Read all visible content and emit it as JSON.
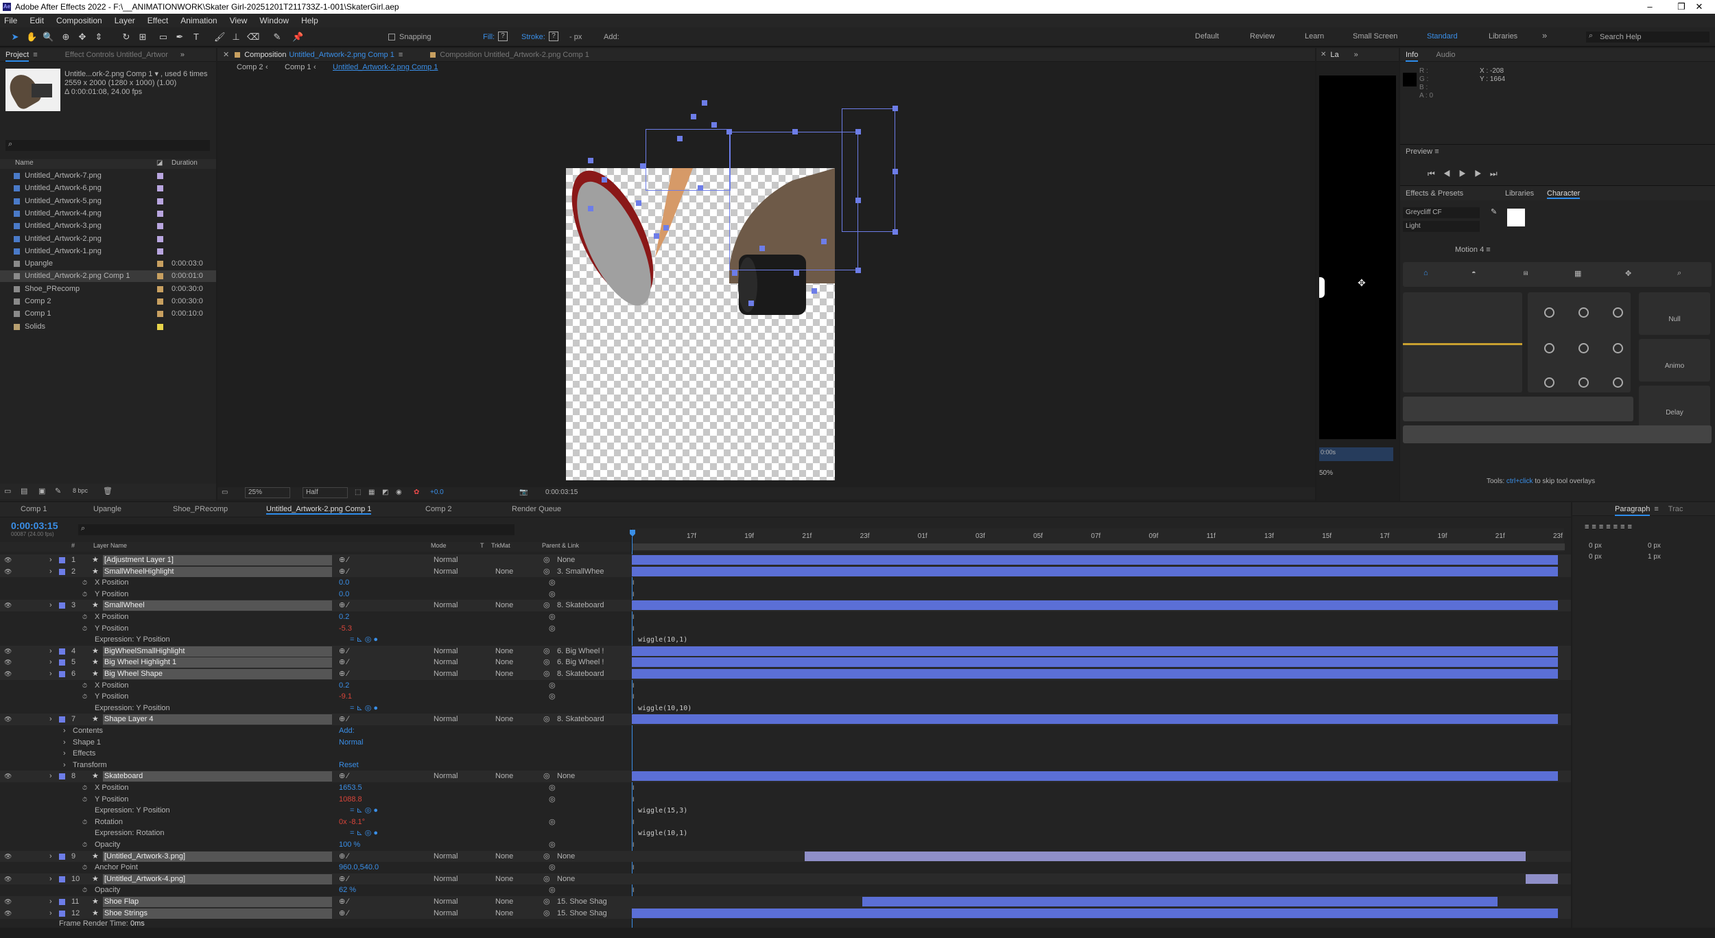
{
  "window": {
    "title": "Adobe After Effects 2022 - F:\\__ANIMATIONWORK\\Skater Girl-20251201T211733Z-1-001\\SkaterGirl.aep",
    "min": "–",
    "max": "❐",
    "close": "✕"
  },
  "menu": [
    "File",
    "Edit",
    "Composition",
    "Layer",
    "Effect",
    "Animation",
    "View",
    "Window",
    "Help"
  ],
  "toolbar": {
    "snapping": "Snapping",
    "fill": "Fill:",
    "stroke": "Stroke:",
    "px": "- px",
    "add": "Add:"
  },
  "workspaces": [
    "Default",
    "Review",
    "Learn",
    "Small Screen",
    "Standard",
    "Libraries"
  ],
  "search_help": "Search Help",
  "project": {
    "tab": "Project",
    "effect_controls": "Effect Controls Untitled_Artwor",
    "thumb_name": "Untitle...ork-2.png Comp 1 ▾ , used 6 times",
    "thumb_dims": "2559 x 2000  (1280 x 1000) (1.00)",
    "thumb_dur": "Δ 0:00:01:08, 24.00 fps",
    "col_name": "Name",
    "col_duration": "Duration",
    "items": [
      {
        "name": "Untitled_Artwork-7.png",
        "dur": "",
        "color": "#b9a6e0"
      },
      {
        "name": "Untitled_Artwork-6.png",
        "dur": "",
        "color": "#b9a6e0"
      },
      {
        "name": "Untitled_Artwork-5.png",
        "dur": "",
        "color": "#b9a6e0"
      },
      {
        "name": "Untitled_Artwork-4.png",
        "dur": "",
        "color": "#b9a6e0"
      },
      {
        "name": "Untitled_Artwork-3.png",
        "dur": "",
        "color": "#b9a6e0"
      },
      {
        "name": "Untitled_Artwork-2.png",
        "dur": "",
        "color": "#b9a6e0"
      },
      {
        "name": "Untitled_Artwork-1.png",
        "dur": "",
        "color": "#b9a6e0"
      },
      {
        "name": "Upangle",
        "dur": "0:00:03:0",
        "color": "#c8a060"
      },
      {
        "name": "Untitled_Artwork-2.png Comp 1",
        "dur": "0:00:01:0",
        "color": "#c8a060"
      },
      {
        "name": "Shoe_PRecomp",
        "dur": "0:00:30:0",
        "color": "#c8a060"
      },
      {
        "name": "Comp 2",
        "dur": "0:00:30:0",
        "color": "#c8a060"
      },
      {
        "name": "Comp 1",
        "dur": "0:00:10:0",
        "color": "#c8a060"
      },
      {
        "name": "Solids",
        "dur": "",
        "color": "#e8d44a"
      }
    ],
    "bpc": "8 bpc"
  },
  "viewer": {
    "tab_comp": "Composition",
    "tab_comp_name": "Untitled_Artwork-2.png Comp 1",
    "tab_other": "Composition Untitled_Artwork-2.png Comp 1",
    "crumbs": [
      "Comp 2",
      "Comp 1",
      "Untitled_Artwork-2.png Comp 1"
    ],
    "zoom": "25%",
    "res": "Half",
    "exposure": "+0.0",
    "time": "0:00:03:15"
  },
  "layer_panel": {
    "tab": "La",
    "time": "0:00s",
    "zoom": "50%"
  },
  "info": {
    "tab": "Info",
    "audio": "Audio",
    "r": "R :",
    "g": "G :",
    "b": "B :",
    "a": "A : 0",
    "x": "X : -208",
    "y": "Y : 1664"
  },
  "preview": {
    "title": "Preview"
  },
  "effects_tabs": [
    "Effects & Presets",
    "Libraries",
    "Character"
  ],
  "character": {
    "font": "Greycliff CF",
    "style": "Light"
  },
  "motion": {
    "title": "Motion 4",
    "null": "Null",
    "animo": "Animo",
    "delay": "Delay",
    "hint_a": "Tools:",
    "hint_b": "ctrl+click",
    "hint_c": "to skip tool overlays"
  },
  "paragraph": {
    "tab": "Paragraph",
    "trac": "Trac",
    "t1": "0 px",
    "t2": "0 px",
    "t3": "0 px",
    "t4": "0 px",
    "t5": "1 px"
  },
  "timeline": {
    "tabs": [
      "Comp 1",
      "Upangle",
      "Shoe_PRecomp",
      "Untitled_Artwork-2.png Comp 1",
      "Comp 2",
      "Render Queue"
    ],
    "time": "0:00:03:15",
    "fps": "00087 (24.00 fps)",
    "cols": {
      "num": "#",
      "name": "Layer Name",
      "mode": "Mode",
      "t": "T",
      "trkmat": "TrkMat",
      "parent": "Parent & Link"
    },
    "ruler": [
      "17f",
      "19f",
      "21f",
      "23f",
      "01f",
      "03f",
      "05f",
      "07f",
      "09f",
      "11f",
      "13f",
      "15f",
      "17f",
      "19f",
      "21f",
      "23f"
    ],
    "rows": [
      {
        "t": "layer",
        "n": "1",
        "name": "[Adjustment Layer 1]",
        "mode": "Normal",
        "trk": "",
        "parent": "None",
        "bar": [
          0,
          1
        ],
        "bc": "#5b6fd6"
      },
      {
        "t": "layer",
        "n": "2",
        "name": "SmallWheelHighlight",
        "mode": "Normal",
        "trk": "None",
        "parent": "3. SmallWhee",
        "bar": [
          0,
          1
        ],
        "bc": "#5b6fd6"
      },
      {
        "t": "prop",
        "name": "X Position",
        "val": "0.0",
        "vc": "#3a8fe8"
      },
      {
        "t": "prop",
        "name": "Y Position",
        "val": "0.0",
        "vc": "#3a8fe8"
      },
      {
        "t": "layer",
        "n": "3",
        "name": "SmallWheel",
        "mode": "Normal",
        "trk": "None",
        "parent": "8. Skateboard",
        "bar": [
          0,
          1
        ],
        "bc": "#5b6fd6"
      },
      {
        "t": "prop",
        "name": "X Position",
        "val": "0.2",
        "vc": "#3a8fe8"
      },
      {
        "t": "prop",
        "name": "Y Position",
        "val": "-5.3",
        "vc": "#d9453a"
      },
      {
        "t": "expr",
        "name": "Expression: Y Position",
        "code": "wiggle(10,1)"
      },
      {
        "t": "layer",
        "n": "4",
        "name": "BigWheelSmallHighlight",
        "mode": "Normal",
        "trk": "None",
        "parent": "6. Big Wheel !",
        "bar": [
          0,
          1
        ],
        "bc": "#5b6fd6"
      },
      {
        "t": "layer",
        "n": "5",
        "name": "Big Wheel Highlight 1",
        "mode": "Normal",
        "trk": "None",
        "parent": "6. Big Wheel !",
        "bar": [
          0,
          1
        ],
        "bc": "#5b6fd6"
      },
      {
        "t": "layer",
        "n": "6",
        "name": "Big Wheel Shape",
        "mode": "Normal",
        "trk": "None",
        "parent": "8. Skateboard",
        "bar": [
          0,
          1
        ],
        "bc": "#5b6fd6"
      },
      {
        "t": "prop",
        "name": "X Position",
        "val": "0.2",
        "vc": "#3a8fe8"
      },
      {
        "t": "prop",
        "name": "Y Position",
        "val": "-9.1",
        "vc": "#d9453a"
      },
      {
        "t": "expr",
        "name": "Expression: Y Position",
        "code": "wiggle(10,10)"
      },
      {
        "t": "layer",
        "n": "7",
        "name": "Shape Layer 4",
        "mode": "Normal",
        "trk": "None",
        "parent": "8. Skateboard",
        "bar": [
          0,
          1
        ],
        "bc": "#5b6fd6"
      },
      {
        "t": "group",
        "name": "Contents",
        "extra": "Add:"
      },
      {
        "t": "group",
        "name": "Shape 1",
        "extra": "Normal"
      },
      {
        "t": "group",
        "name": "Effects",
        "extra": ""
      },
      {
        "t": "group",
        "name": "Transform",
        "extra": "Reset"
      },
      {
        "t": "layer",
        "n": "8",
        "name": "Skateboard",
        "mode": "Normal",
        "trk": "None",
        "parent": "None",
        "bar": [
          0,
          1
        ],
        "bc": "#5b6fd6"
      },
      {
        "t": "prop",
        "name": "X Position",
        "val": "1653.5",
        "vc": "#3a8fe8"
      },
      {
        "t": "prop",
        "name": "Y Position",
        "val": "1088.8",
        "vc": "#d9453a"
      },
      {
        "t": "expr",
        "name": "Expression: Y Position",
        "code": "wiggle(15,3)"
      },
      {
        "t": "prop",
        "name": "Rotation",
        "val": "0x -8.1°",
        "vc": "#d9453a"
      },
      {
        "t": "expr",
        "name": "Expression: Rotation",
        "code": "wiggle(10,1)"
      },
      {
        "t": "prop",
        "name": "Opacity",
        "val": "100 %",
        "vc": "#3a8fe8"
      },
      {
        "t": "layer",
        "n": "9",
        "name": "[Untitled_Artwork-3.png]",
        "mode": "Normal",
        "trk": "None",
        "parent": "None",
        "bar": [
          0.187,
          0.965
        ],
        "bc": "#8f8fc8"
      },
      {
        "t": "prop",
        "name": "Anchor Point",
        "val": "960.0,540.0",
        "vc": "#3a8fe8"
      },
      {
        "t": "layer",
        "n": "10",
        "name": "[Untitled_Artwork-4.png]",
        "mode": "Normal",
        "trk": "None",
        "parent": "None",
        "bar": [
          0.965,
          1
        ],
        "bc": "#8f8fc8"
      },
      {
        "t": "prop",
        "name": "Opacity",
        "val": "62 %",
        "vc": "#3a8fe8"
      },
      {
        "t": "layer",
        "n": "11",
        "name": "Shoe Flap",
        "mode": "Normal",
        "trk": "None",
        "parent": "15. Shoe Shag",
        "bar": [
          0.249,
          0.935
        ],
        "bc": "#5b6fd6"
      },
      {
        "t": "layer",
        "n": "12",
        "name": "Shoe Strings",
        "mode": "Normal",
        "trk": "None",
        "parent": "15. Shoe Shag",
        "bar": [
          0,
          1
        ],
        "bc": "#5b6fd6"
      }
    ],
    "render_time_label": "Frame Render Time:",
    "render_time": "0ms"
  }
}
